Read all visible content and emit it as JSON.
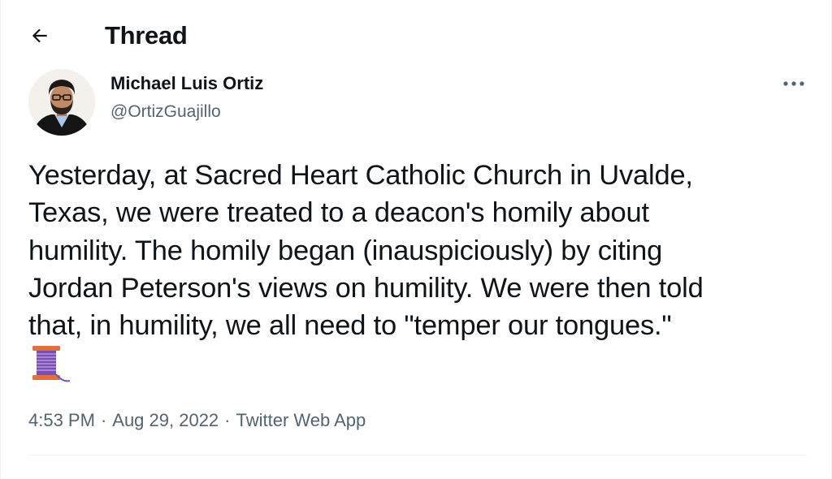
{
  "header": {
    "back_icon": "arrow-left-icon",
    "title": "Thread"
  },
  "tweet": {
    "author": {
      "name": "Michael Luis Ortiz",
      "handle": "@OrtizGuajillo"
    },
    "more_icon": "more-horizontal-icon",
    "text": "Yesterday, at Sacred Heart Catholic Church in Uvalde,\nTexas, we were treated to a deacon's homily about\nhumility. The homily began (inauspiciously) by citing\nJordan Peterson's views on humility. We were then told\nthat, in humility, we all need to \"temper our tongues.\"",
    "emoji_icon": "thread-spool-icon",
    "meta": {
      "time": "4:53 PM",
      "date": "Aug 29, 2022",
      "source": "Twitter Web App",
      "separator": "·"
    }
  },
  "colors": {
    "text_primary": "#0f1419",
    "text_secondary": "#536471",
    "divider": "#eff3f4"
  }
}
